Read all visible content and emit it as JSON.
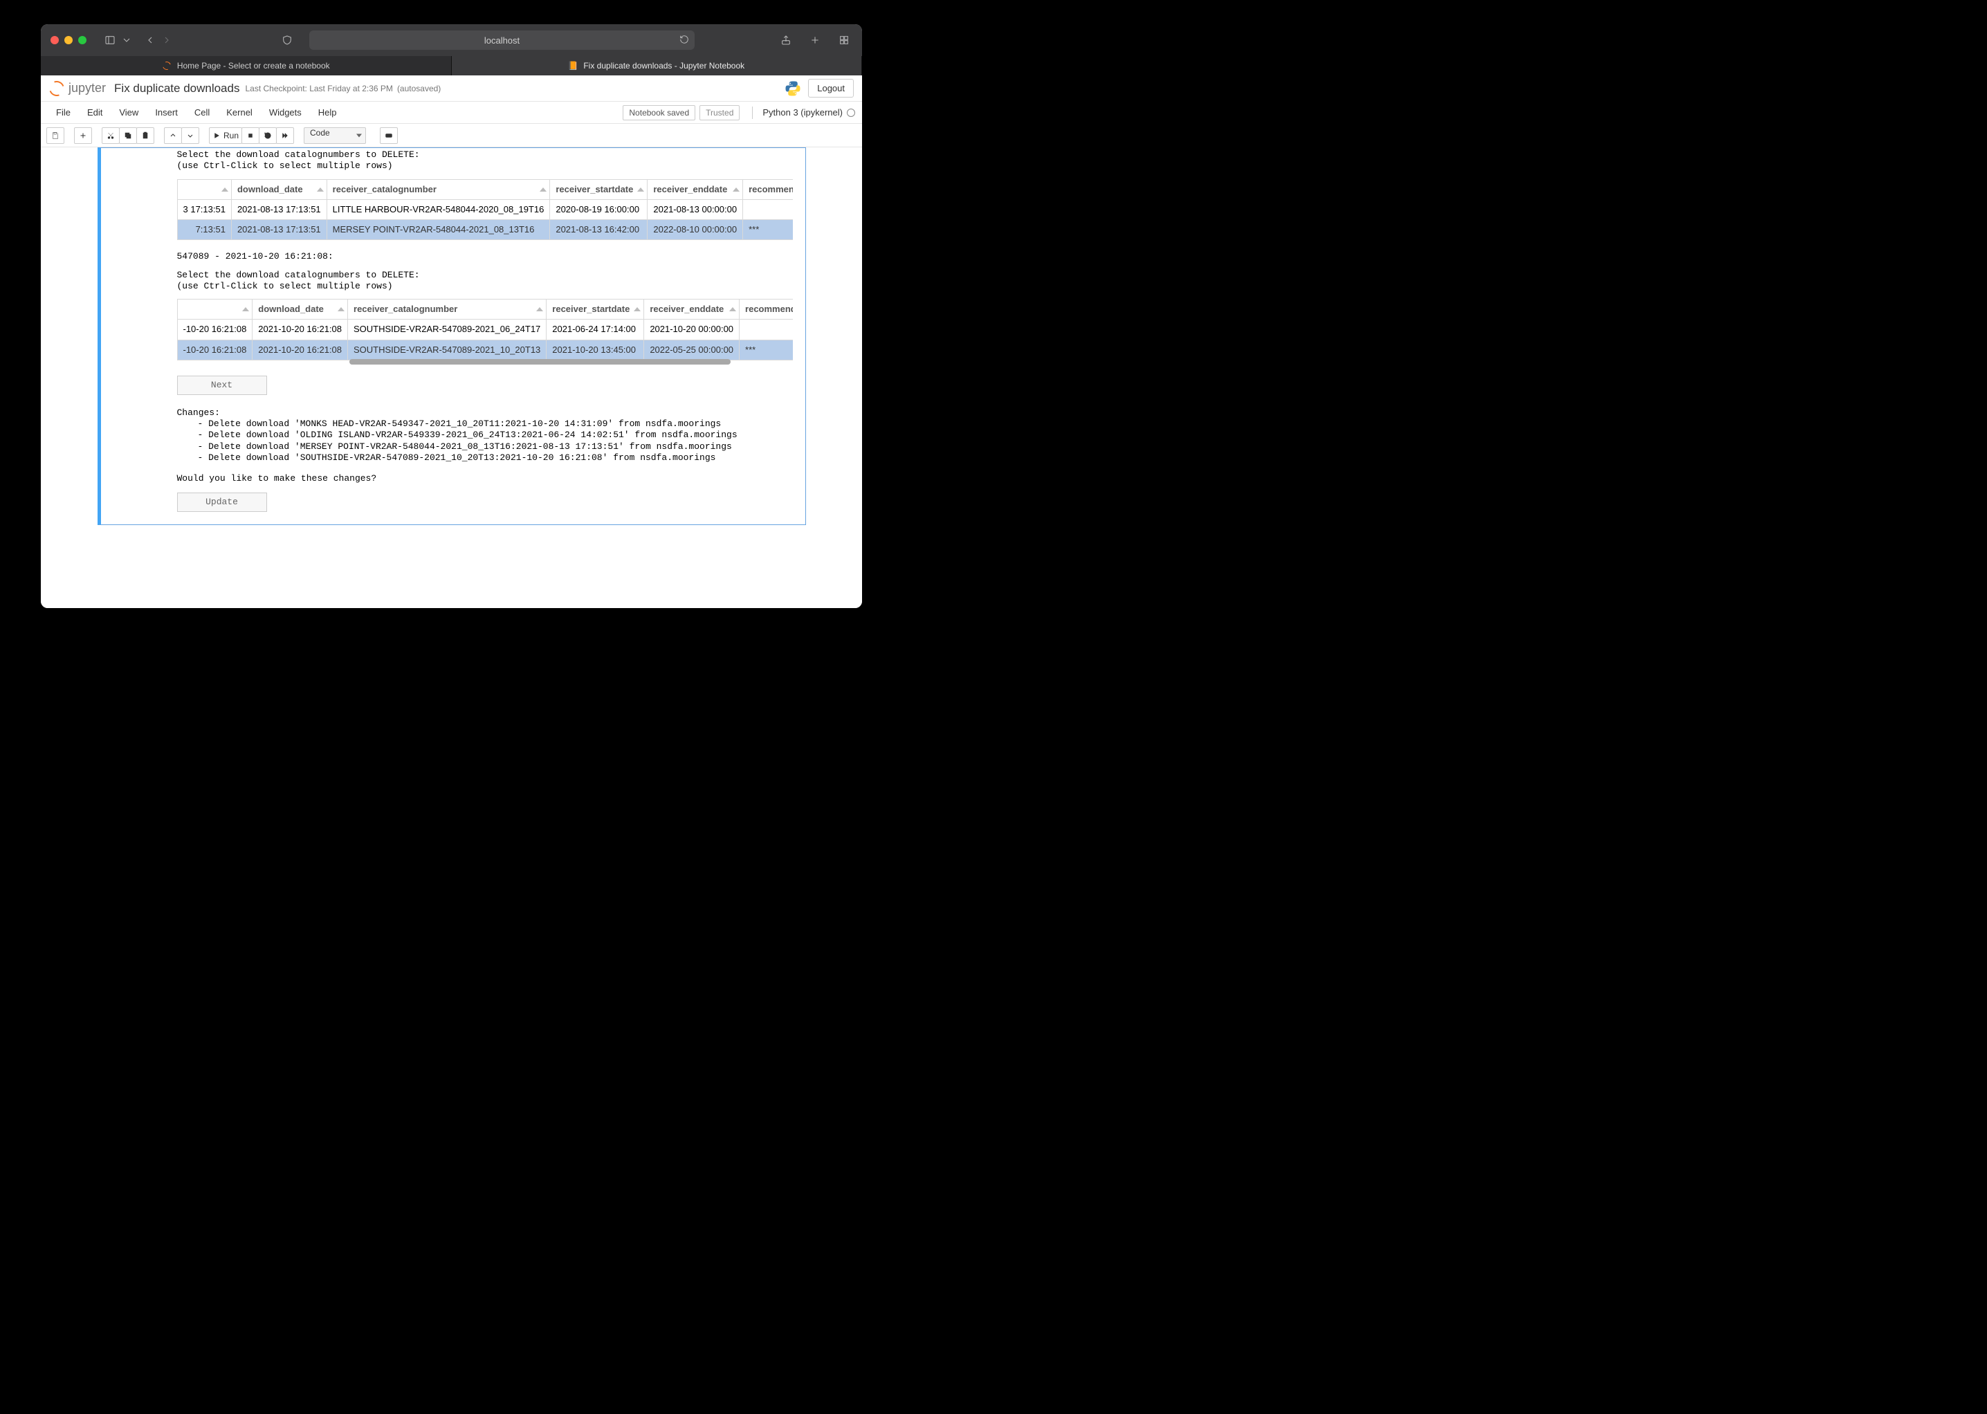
{
  "browser": {
    "url_host": "localhost",
    "tabs": [
      {
        "label": "Home Page - Select or create a notebook"
      },
      {
        "label": "Fix duplicate downloads - Jupyter Notebook"
      }
    ]
  },
  "notebook": {
    "brand": "jupyter",
    "title": "Fix duplicate downloads",
    "checkpoint": "Last Checkpoint: Last Friday at 2:36 PM",
    "autosaved": "(autosaved)",
    "logout": "Logout",
    "menus": [
      "File",
      "Edit",
      "View",
      "Insert",
      "Cell",
      "Kernel",
      "Widgets",
      "Help"
    ],
    "status_saved": "Notebook saved",
    "trusted": "Trusted",
    "kernel_name": "Python 3 (ipykernel)",
    "toolbar": {
      "run_label": "Run",
      "celltype": "Code"
    }
  },
  "output": {
    "instructions": "Select the download catalognumbers to DELETE:\n(use Ctrl-Click to select multiple rows)",
    "table1": {
      "cols": [
        "",
        "download_date",
        "receiver_catalognumber",
        "receiver_startdate",
        "receiver_enddate",
        "recommended"
      ],
      "rows": [
        {
          "c0": "3 17:13:51",
          "c1": "2021-08-13 17:13:51",
          "c2": "LITTLE HARBOUR-VR2AR-548044-2020_08_19T16",
          "c3": "2020-08-19 16:00:00",
          "c4": "2021-08-13 00:00:00",
          "c5": ""
        },
        {
          "c0": "7:13:51",
          "c1": "2021-08-13 17:13:51",
          "c2": "MERSEY POINT-VR2AR-548044-2021_08_13T16",
          "c3": "2021-08-13 16:42:00",
          "c4": "2022-08-10 00:00:00",
          "c5": "***"
        }
      ]
    },
    "heading2": "547089 - 2021-10-20 16:21:08:",
    "table2": {
      "cols": [
        "",
        "download_date",
        "receiver_catalognumber",
        "receiver_startdate",
        "receiver_enddate",
        "recommended"
      ],
      "rows": [
        {
          "c0": "-10-20 16:21:08",
          "c1": "2021-10-20 16:21:08",
          "c2": "SOUTHSIDE-VR2AR-547089-2021_06_24T17",
          "c3": "2021-06-24 17:14:00",
          "c4": "2021-10-20 00:00:00",
          "c5": ""
        },
        {
          "c0": "-10-20 16:21:08",
          "c1": "2021-10-20 16:21:08",
          "c2": "SOUTHSIDE-VR2AR-547089-2021_10_20T13",
          "c3": "2021-10-20 13:45:00",
          "c4": "2022-05-25 00:00:00",
          "c5": "***"
        }
      ]
    },
    "next": "Next",
    "changes_heading": "Changes:",
    "changes": [
      "- Delete download 'MONKS HEAD-VR2AR-549347-2021_10_20T11:2021-10-20 14:31:09' from nsdfa.moorings",
      "- Delete download 'OLDING ISLAND-VR2AR-549339-2021_06_24T13:2021-06-24 14:02:51' from nsdfa.moorings",
      "- Delete download 'MERSEY POINT-VR2AR-548044-2021_08_13T16:2021-08-13 17:13:51' from nsdfa.moorings",
      "- Delete download 'SOUTHSIDE-VR2AR-547089-2021_10_20T13:2021-10-20 16:21:08' from nsdfa.moorings"
    ],
    "confirm": "Would you like to make these changes?",
    "update": "Update"
  }
}
